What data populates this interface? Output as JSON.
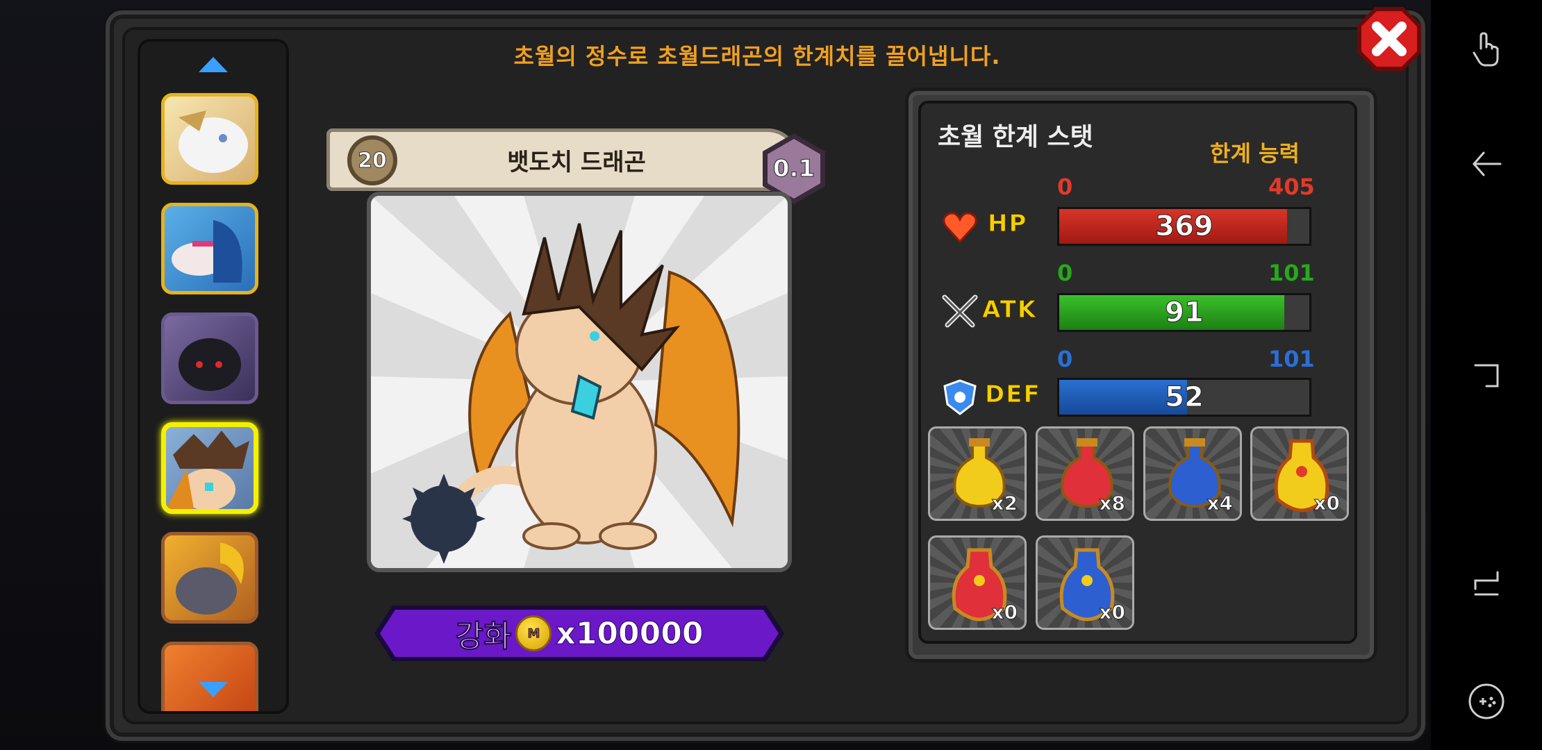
{
  "header": {
    "message": "초월의 정수로 초월드래곤의 한계치를 끌어냅니다."
  },
  "dragon": {
    "level": "20",
    "name": "뱃도치 드래곤",
    "grade": "0.1"
  },
  "upgrade": {
    "label": "강화",
    "coin_icon_text": "M",
    "cost": "x100000"
  },
  "stats": {
    "title": "초월 한계 스탯",
    "limit_label": "한계 능력",
    "hp": {
      "name": "HP",
      "min": "0",
      "max": "405",
      "value": "369",
      "color": "#b8221c",
      "min_color": "#e23a2a",
      "max_color": "#e23a2a"
    },
    "atk": {
      "name": "ATK",
      "min": "0",
      "max": "101",
      "value": "91",
      "color": "#2a9a1c",
      "min_color": "#28a81c",
      "max_color": "#28a81c"
    },
    "def": {
      "name": "DEF",
      "min": "0",
      "max": "101",
      "value": "52",
      "color": "#1a5bb0",
      "min_color": "#2a6fd8",
      "max_color": "#2a6fd8"
    }
  },
  "items": [
    {
      "name": "yellow-potion",
      "count": "x2",
      "color": "#f2cc1a"
    },
    {
      "name": "red-potion",
      "count": "x8",
      "color": "#e0303a"
    },
    {
      "name": "blue-potion",
      "count": "x4",
      "color": "#2d5fd0"
    },
    {
      "name": "gold-grand-potion",
      "count": "x0",
      "color": "#f2cc1a"
    },
    {
      "name": "red-grand-potion",
      "count": "x0",
      "color": "#e0303a"
    },
    {
      "name": "blue-grand-potion",
      "count": "x0",
      "color": "#2d5fd0"
    }
  ],
  "dragon_list": [
    {
      "name": "white-dragon"
    },
    {
      "name": "sea-dragon"
    },
    {
      "name": "dark-dragon"
    },
    {
      "name": "hedgehog-dragon"
    },
    {
      "name": "golden-horn-dragon"
    },
    {
      "name": "orange-dragon"
    }
  ]
}
